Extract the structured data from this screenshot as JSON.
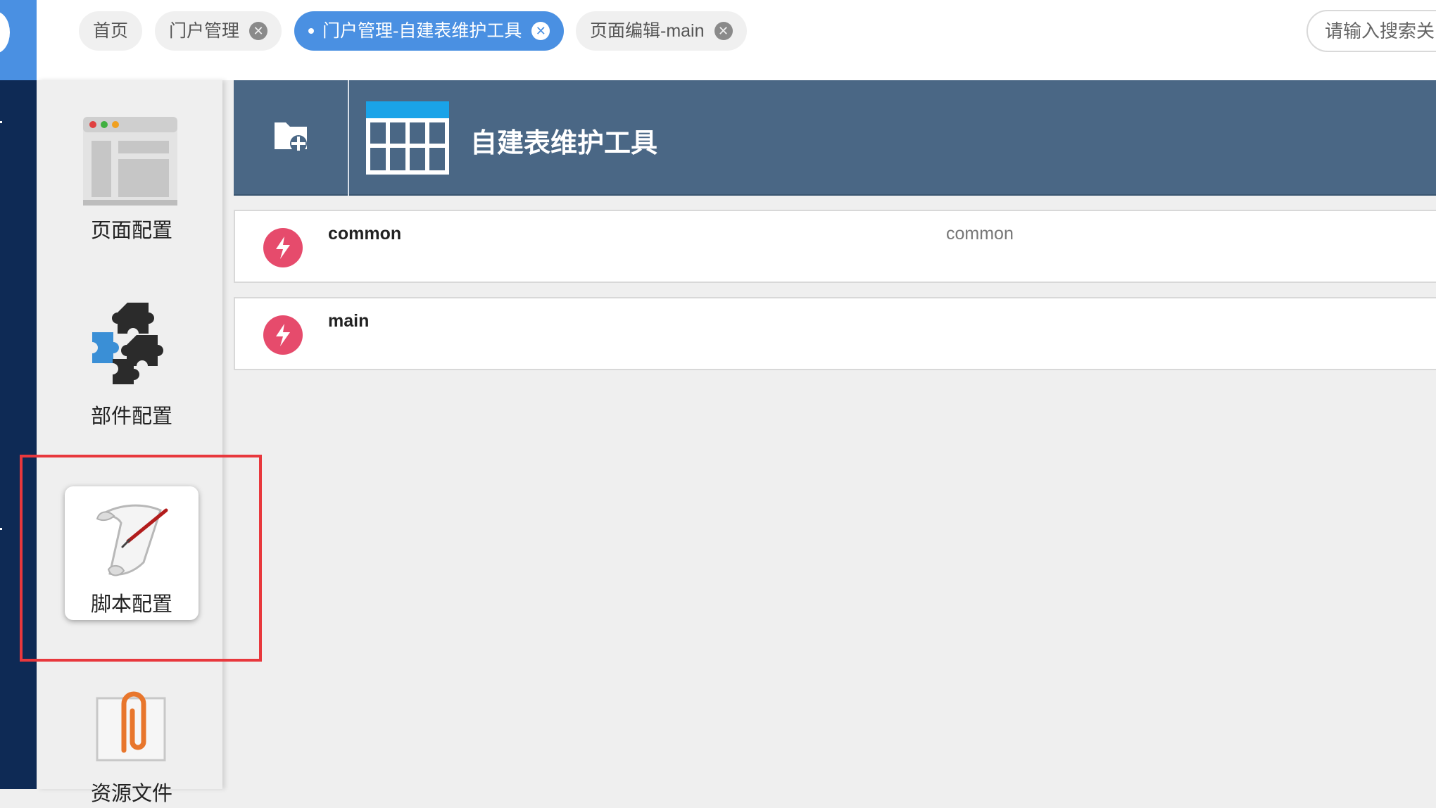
{
  "tabs": [
    {
      "label": "首页",
      "closable": false,
      "active": false
    },
    {
      "label": "门户管理",
      "closable": true,
      "active": false
    },
    {
      "label": "门户管理-自建表维护工具",
      "closable": true,
      "active": true
    },
    {
      "label": "页面编辑-main",
      "closable": true,
      "active": false
    }
  ],
  "search": {
    "placeholder": "请输入搜索关"
  },
  "sidebar": {
    "items": [
      {
        "label": "页面配置",
        "icon": "browser-window-icon"
      },
      {
        "label": "部件配置",
        "icon": "puzzle-pieces-icon"
      },
      {
        "label": "脚本配置",
        "icon": "scroll-pen-icon",
        "selected": true
      },
      {
        "label": "资源文件",
        "icon": "paperclip-file-icon"
      }
    ]
  },
  "content": {
    "title": "自建表维护工具",
    "rows": [
      {
        "name": "common",
        "description": "common"
      },
      {
        "name": "main",
        "description": ""
      }
    ]
  },
  "colors": {
    "accent": "#4a90e2",
    "nav_dark": "#0e2a55",
    "header_bg": "#4a6785",
    "row_icon": "#e64b6c",
    "highlight": "#e8383d"
  }
}
